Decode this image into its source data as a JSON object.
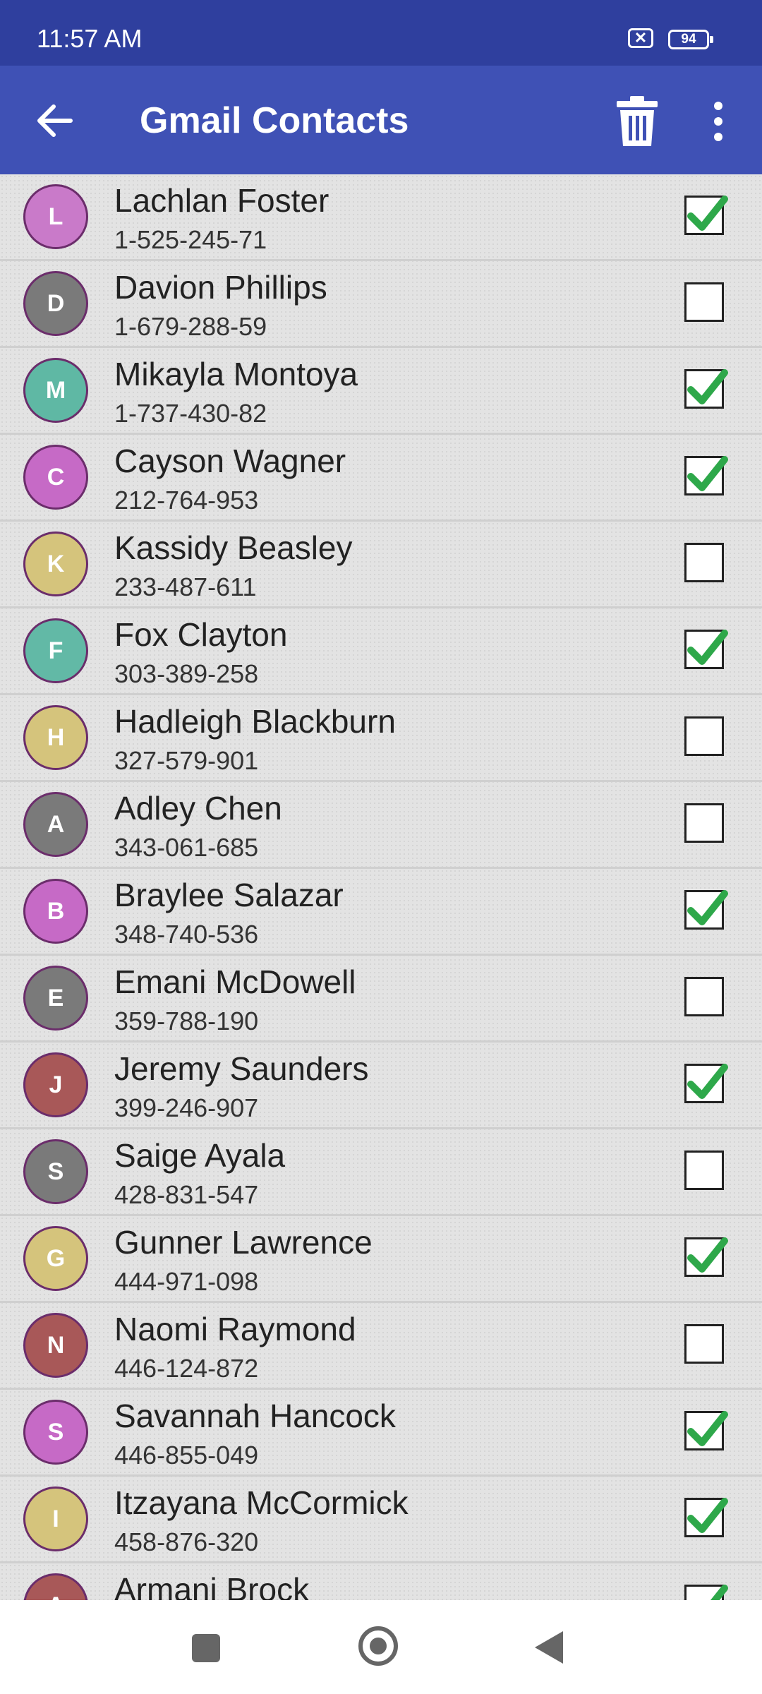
{
  "status_bar": {
    "time": "11:57 AM",
    "battery": "94",
    "notification_glyph": "✕"
  },
  "app_bar": {
    "title": "Gmail Contacts",
    "back_icon": "back-arrow-icon",
    "delete_icon": "trash-icon",
    "menu_icon": "more-vert-icon"
  },
  "colors": {
    "status_bar": "#2f3f9e",
    "app_bar": "#3f51b5",
    "check_green": "#2ea84a"
  },
  "contacts": [
    {
      "initial": "L",
      "name": "Lachlan Foster",
      "phone": "1-525-245-71",
      "color": "#c97ac9",
      "checked": true
    },
    {
      "initial": "D",
      "name": "Davion Phillips",
      "phone": "1-679-288-59",
      "color": "#7a7a7a",
      "checked": false
    },
    {
      "initial": "M",
      "name": "Mikayla Montoya",
      "phone": "1-737-430-82",
      "color": "#5fb8a4",
      "checked": true
    },
    {
      "initial": "C",
      "name": "Cayson Wagner",
      "phone": "212-764-953",
      "color": "#c66ac6",
      "checked": true
    },
    {
      "initial": "K",
      "name": "Kassidy Beasley",
      "phone": "233-487-611",
      "color": "#d5c47c",
      "checked": false
    },
    {
      "initial": "F",
      "name": "Fox Clayton",
      "phone": "303-389-258",
      "color": "#62b9a6",
      "checked": true
    },
    {
      "initial": "H",
      "name": "Hadleigh Blackburn",
      "phone": "327-579-901",
      "color": "#d5c47c",
      "checked": false
    },
    {
      "initial": "A",
      "name": "Adley Chen",
      "phone": "343-061-685",
      "color": "#7a7a7a",
      "checked": false
    },
    {
      "initial": "B",
      "name": "Braylee Salazar",
      "phone": "348-740-536",
      "color": "#c66ac6",
      "checked": true
    },
    {
      "initial": "E",
      "name": "Emani McDowell",
      "phone": "359-788-190",
      "color": "#7a7a7a",
      "checked": false
    },
    {
      "initial": "J",
      "name": "Jeremy Saunders",
      "phone": "399-246-907",
      "color": "#a85858",
      "checked": true
    },
    {
      "initial": "S",
      "name": "Saige Ayala",
      "phone": "428-831-547",
      "color": "#7a7a7a",
      "checked": false
    },
    {
      "initial": "G",
      "name": "Gunner Lawrence",
      "phone": "444-971-098",
      "color": "#d5c47c",
      "checked": true
    },
    {
      "initial": "N",
      "name": "Naomi Raymond",
      "phone": "446-124-872",
      "color": "#a85858",
      "checked": false
    },
    {
      "initial": "S",
      "name": "Savannah Hancock",
      "phone": "446-855-049",
      "color": "#c66ac6",
      "checked": true
    },
    {
      "initial": "I",
      "name": "Itzayana McCormick",
      "phone": "458-876-320",
      "color": "#d5c47c",
      "checked": true
    },
    {
      "initial": "A",
      "name": "Armani Brock",
      "phone": "",
      "color": "#a85858",
      "checked": true
    }
  ],
  "nav_bar": {
    "recents_icon": "square-icon",
    "home_icon": "home-circle-icon",
    "back_icon": "triangle-back-icon"
  }
}
